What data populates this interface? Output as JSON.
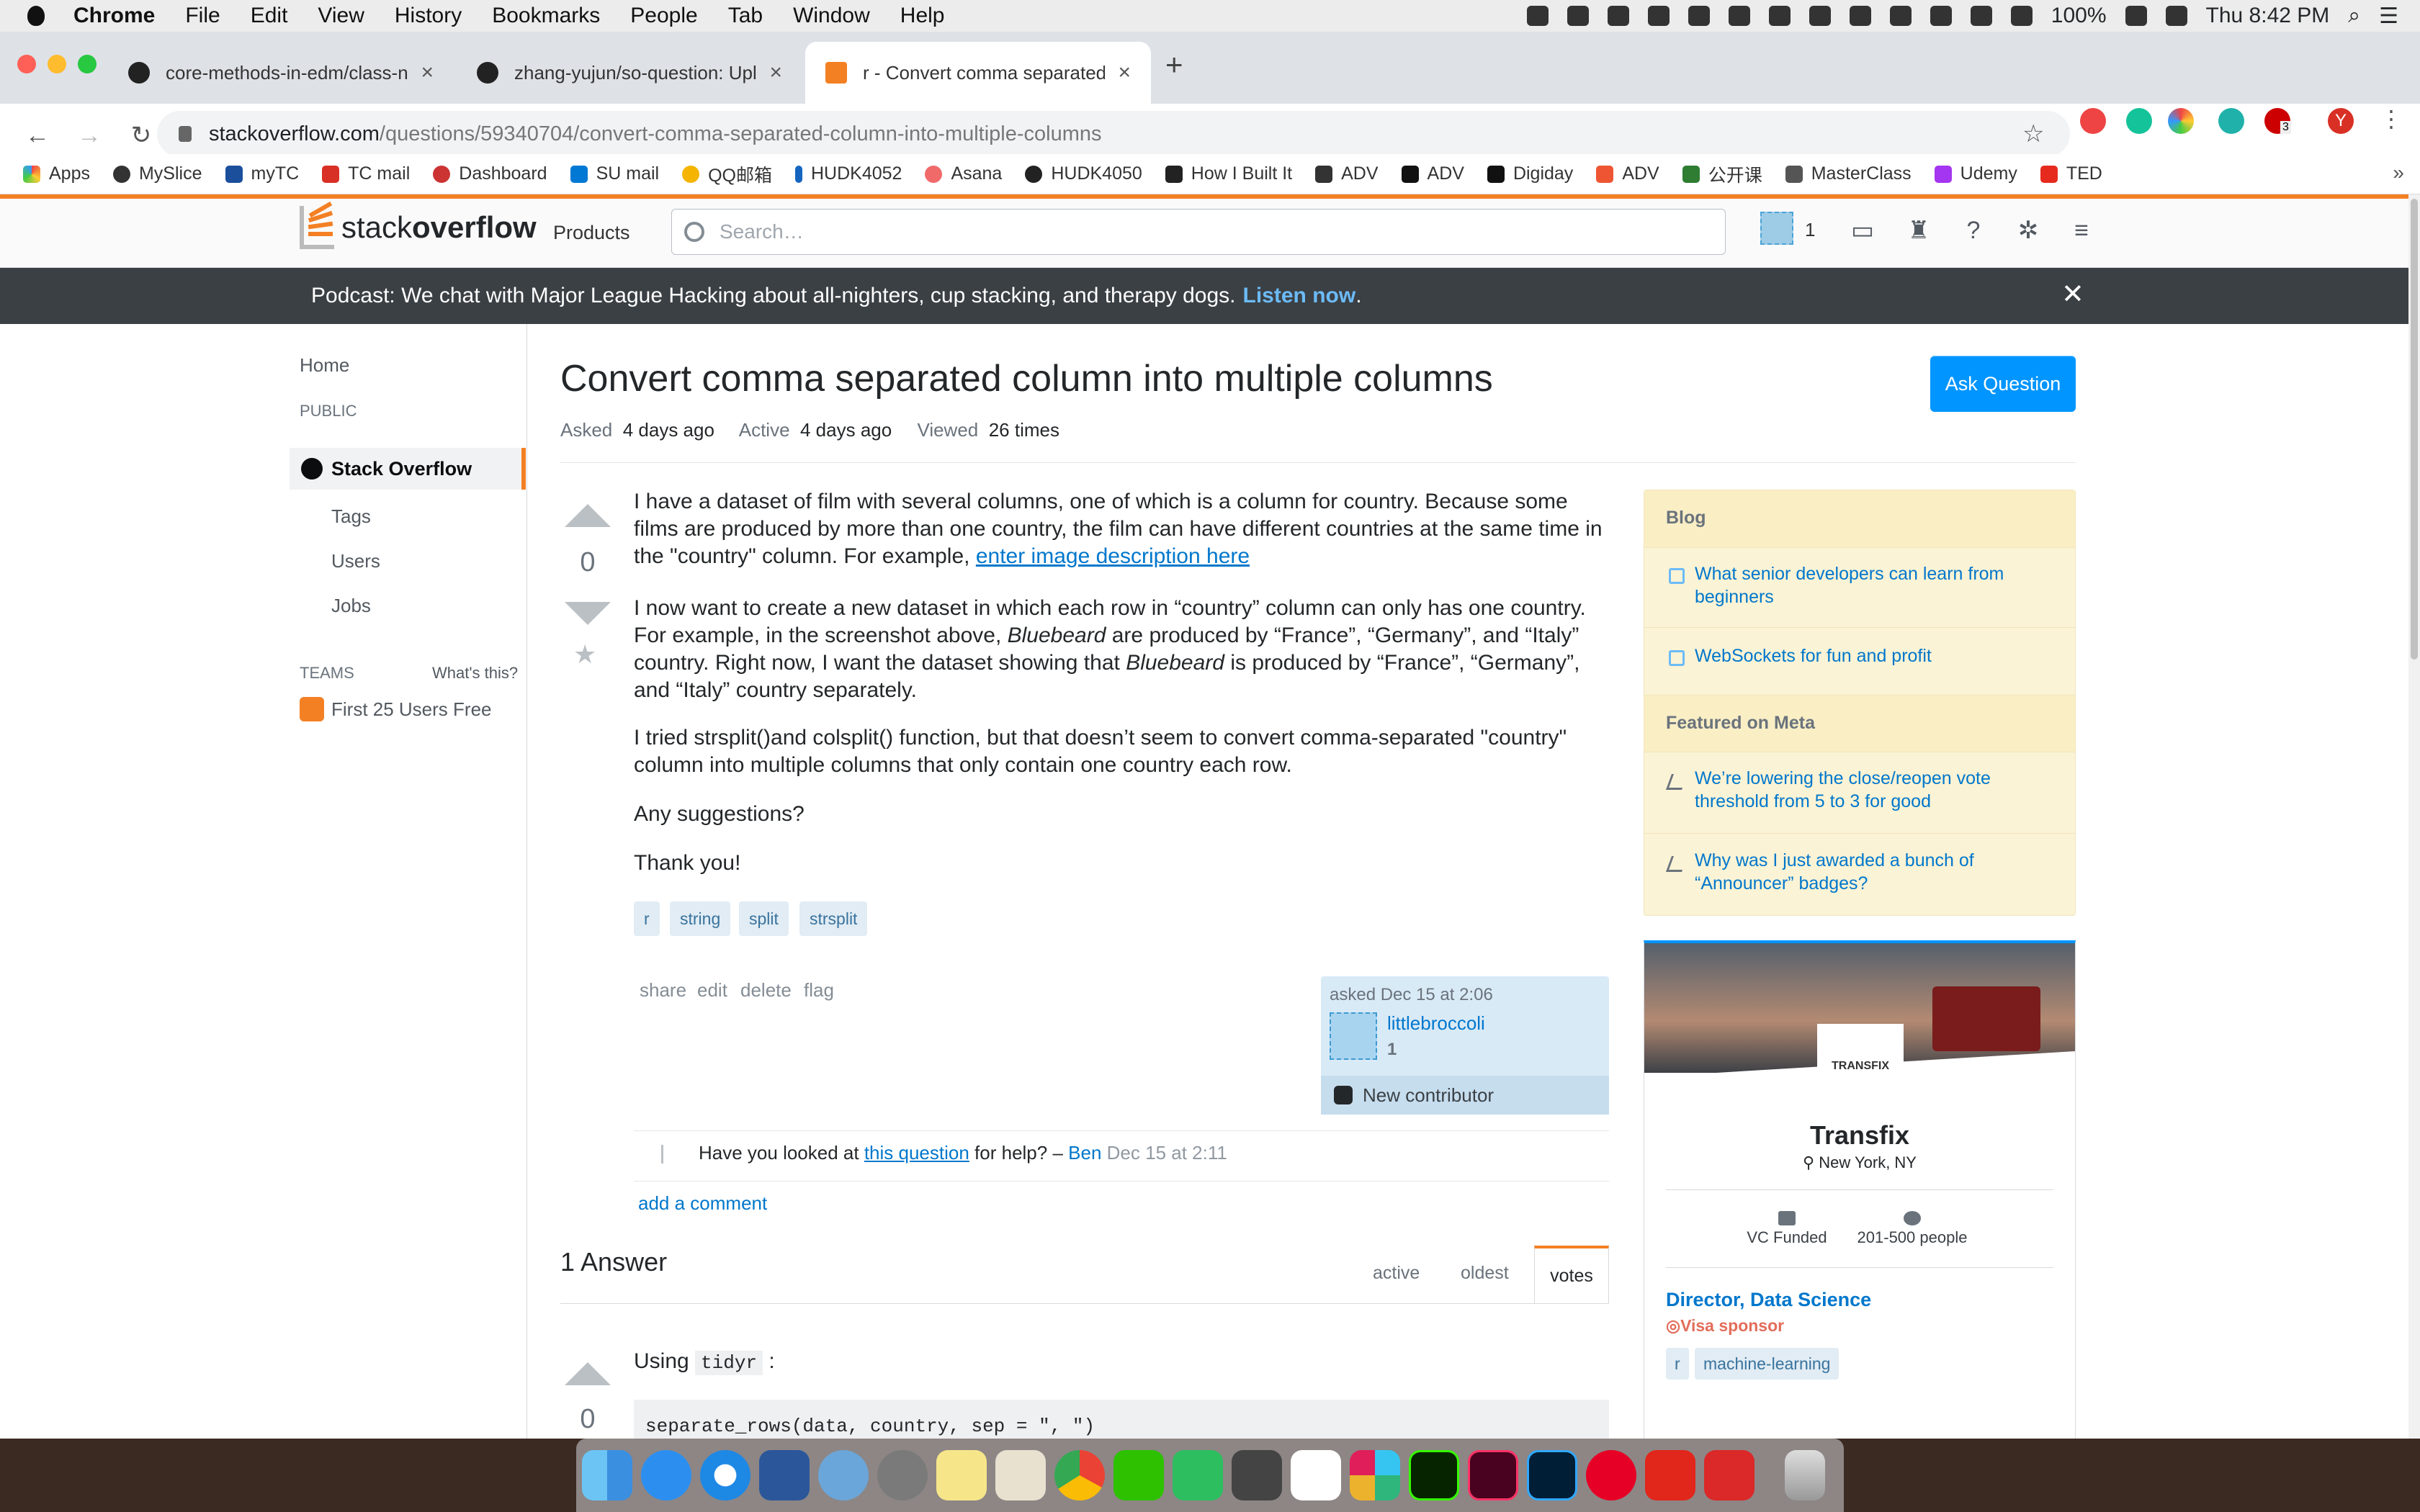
{
  "menubar": {
    "app": "Chrome",
    "items": [
      "File",
      "Edit",
      "View",
      "History",
      "Bookmarks",
      "People",
      "Tab",
      "Window",
      "Help"
    ],
    "battery": "100%",
    "clock": "Thu 8:42 PM"
  },
  "tabs": [
    {
      "title": "core-methods-in-edm/class-n"
    },
    {
      "title": "zhang-yujun/so-question: Uplo"
    },
    {
      "title": "r - Convert comma separated c"
    }
  ],
  "address": {
    "domain": "stackoverflow.com",
    "path": "/questions/59340704/convert-comma-separated-column-into-multiple-columns"
  },
  "profile_initial": "Y",
  "extension_badge": "3",
  "bookmarks": [
    "Apps",
    "MySlice",
    "myTC",
    "TC mail",
    "Dashboard",
    "SU mail",
    "QQ邮箱",
    "HUDK4052",
    "Asana",
    "HUDK4050",
    "How I Built It",
    "ADV",
    "ADV",
    "Digiday",
    "ADV",
    "公开课",
    "MasterClass",
    "Udemy",
    "TED"
  ],
  "so_header": {
    "logo_a": "stack",
    "logo_b": "overflow",
    "products": "Products",
    "search_placeholder": "Search…",
    "rep": "1"
  },
  "banner": {
    "text": "Podcast: We chat with Major League Hacking about all-nighters, cup stacking, and therapy dogs.",
    "link": "Listen now",
    "end": "."
  },
  "nav": {
    "home": "Home",
    "public": "PUBLIC",
    "stack_overflow": "Stack Overflow",
    "tags": "Tags",
    "users": "Users",
    "jobs": "Jobs",
    "teams": "TEAMS",
    "whats_this": "What's this?",
    "first25": "First 25 Users Free"
  },
  "question": {
    "title": "Convert comma separated column into multiple columns",
    "ask_button": "Ask Question",
    "asked_label": "Asked",
    "asked_value": "4 days ago",
    "active_label": "Active",
    "active_value": "4 days ago",
    "viewed_label": "Viewed",
    "viewed_value": "26 times",
    "votes": "0",
    "p1": "I have a dataset of film with several columns, one of which is a column for country. Because some films are produced by more than one country, the film can have different countries at the same time in the \"country\" column. For example,",
    "p1_link": "enter image description here",
    "p2a": "I now want to create a new dataset in which each row in “country” column can only has one country. For example, in the screenshot above,",
    "p2_em1": "Bluebeard",
    "p2b": "are produced by “France”, “Germany”, and “Italy” country. Right now, I want the dataset showing that",
    "p2_em2": "Bluebeard",
    "p2c": "is produced by “France”, “Germany”, and “Italy” country separately.",
    "p3": "I tried strsplit()and colsplit() function, but that doesn’t seem to convert comma-separated \"country\" column into multiple columns that only contain one country each row.",
    "p4": "Any suggestions?",
    "p5": "Thank you!",
    "tags": [
      "r",
      "string",
      "split",
      "strsplit"
    ],
    "post_links": [
      "share",
      "edit",
      "delete",
      "flag"
    ],
    "asked_time": "asked Dec 15 at 2:06",
    "user": "littlebroccoli",
    "user_rep": "1",
    "new_contributor": "New contributor",
    "comment_a": "Have you looked at",
    "comment_link": "this question",
    "comment_b": "for help? –",
    "comment_author": "Ben",
    "comment_date": "Dec 15 at 2:11",
    "add_comment": "add a comment"
  },
  "answers": {
    "count": "1 Answer",
    "sort": [
      "active",
      "oldest",
      "votes"
    ],
    "votes": "0",
    "using": "Using",
    "using_code": "tidyr",
    "using_end": ":",
    "code": "separate_rows(data, country, sep = \", \")"
  },
  "sidebar": {
    "blog_head": "Blog",
    "blog_items": [
      "What senior developers can learn from beginners",
      "WebSockets for fun and profit"
    ],
    "meta_head": "Featured on Meta",
    "meta_items": [
      "We’re lowering the close/reopen vote threshold from 5 to 3 for good",
      "Why was I just awarded a bunch of “Announcer” badges?"
    ]
  },
  "ad": {
    "logo": "TRANSFIX",
    "company": "Transfix",
    "location": "New York, NY",
    "stat1": "VC Funded",
    "stat2": "201-500 people",
    "job_title": "Director, Data Science",
    "visa": "Visa sponsor",
    "tags": [
      "r",
      "machine-learning"
    ]
  },
  "colors": {
    "accent": "#f48024",
    "link": "#0077cc",
    "button": "#0095ff"
  }
}
